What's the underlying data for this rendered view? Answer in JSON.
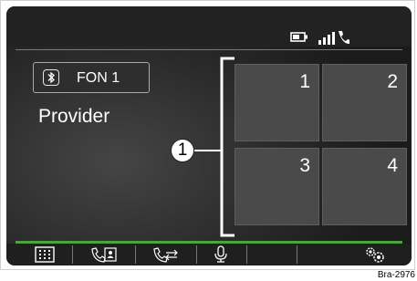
{
  "status": {
    "battery_icon": "battery-icon",
    "signal_icon": "signal-phone-icon"
  },
  "phone": {
    "bluetooth_icon": "bluetooth-icon",
    "label": "FON 1",
    "provider": "Provider"
  },
  "favorites": {
    "tiles": [
      "1",
      "2",
      "3",
      "4"
    ],
    "callout": "1"
  },
  "bottom_bar": {
    "buttons": [
      {
        "name": "keypad",
        "icon": "keypad-icon"
      },
      {
        "name": "contacts",
        "icon": "phonebook-icon"
      },
      {
        "name": "call-list",
        "icon": "call-list-icon"
      },
      {
        "name": "voice",
        "icon": "microphone-icon"
      },
      {
        "name": "empty-slot",
        "icon": ""
      },
      {
        "name": "settings",
        "icon": "settings-gears-icon"
      }
    ]
  },
  "reference_code": "Bra-2976",
  "colors": {
    "accent_green": "#4ea33e",
    "screen_bg": "#2a2a2a",
    "tile_bg": "#4a4a4a"
  }
}
